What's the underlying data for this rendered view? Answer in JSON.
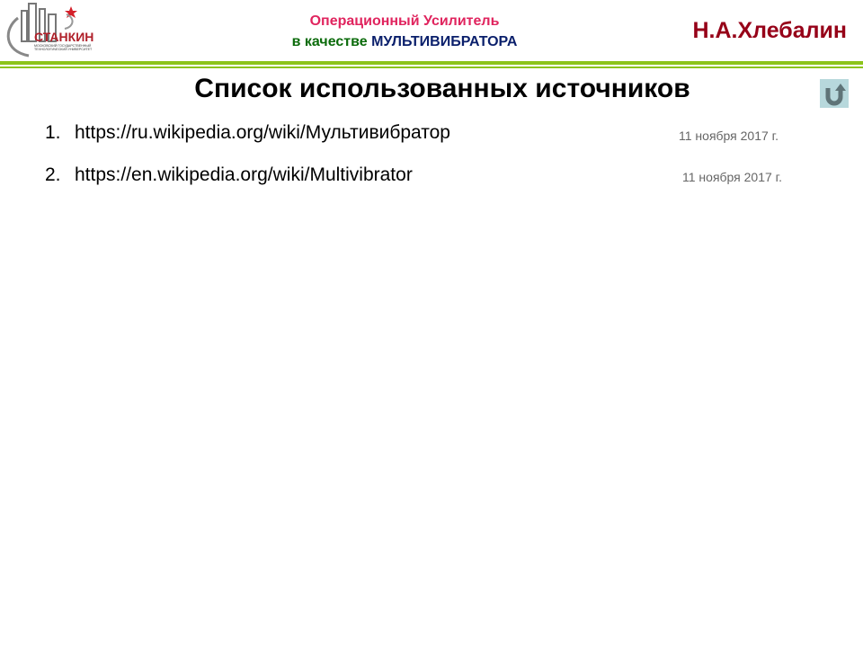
{
  "logo": {
    "name": "СТАНКИН",
    "subtitle": "МОСКОВСКИЙ ГОСУДАРСТВЕННЫЙ ТЕХНОЛОГИЧЕСКИЙ УНИВЕРСИТЕТ",
    "star_color": "#d4202a"
  },
  "header": {
    "line1": "Операционный Усилитель",
    "line2_prefix": "в качестве",
    "line2_main": "МУЛЬТИВИБРАТОРА",
    "author": "Н.А.Хлебалин"
  },
  "slide": {
    "title": "Список использованных источников",
    "back_icon": "return-arrow-icon",
    "sources": [
      {
        "num": "1.",
        "url": "https://ru.wikipedia.org/wiki/Мультивибратор",
        "date": "11 ноября 2017 г."
      },
      {
        "num": "2.",
        "url": "https://en.wikipedia.org/wiki/Multivibrator",
        "date": "11 ноября 2017 г."
      }
    ]
  },
  "colors": {
    "accent_line": "#8cc41a",
    "author": "#960018",
    "header_pink": "#e0245e",
    "header_green": "#0b6b0b",
    "header_navy": "#0a1f6b"
  }
}
